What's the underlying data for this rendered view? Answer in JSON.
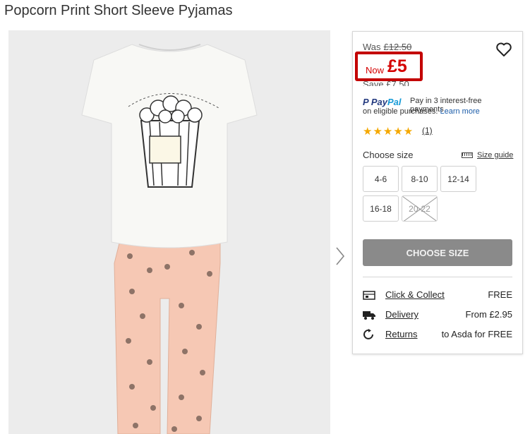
{
  "product": {
    "title": "Popcorn Print Short Sleeve Pyjamas"
  },
  "image_area": {
    "description_icon": "product-photo",
    "next_icon": "chevron-right-icon"
  },
  "price": {
    "was_label": "Was",
    "was_price": "£12.50",
    "now_label": "Now",
    "now_price": "£5",
    "save_text": "Save £7.50",
    "colors": {
      "now": "#d40000",
      "highlight_box": "#c30000"
    }
  },
  "paypal": {
    "logo_pay": "Pay",
    "logo_pal": "Pal",
    "line1": "Pay in 3 interest-free payments",
    "line2": "on eligible purchases.",
    "learn_more": "Learn more"
  },
  "rating": {
    "stars": 5,
    "max": 5,
    "count": "(1)"
  },
  "sizes": {
    "label": "Choose size",
    "guide_label": "Size guide",
    "options": [
      {
        "label": "4-6",
        "available": true
      },
      {
        "label": "8-10",
        "available": true
      },
      {
        "label": "12-14",
        "available": true
      },
      {
        "label": "16-18",
        "available": true
      },
      {
        "label": "20-22",
        "available": false
      }
    ]
  },
  "cta": {
    "label": "CHOOSE SIZE"
  },
  "delivery": [
    {
      "icon": "store-icon",
      "label": "Click & Collect",
      "value": "FREE"
    },
    {
      "icon": "truck-icon",
      "label": "Delivery",
      "value": "From £2.95"
    },
    {
      "icon": "returns-icon",
      "label": "Returns",
      "value": "to Asda for FREE"
    }
  ]
}
